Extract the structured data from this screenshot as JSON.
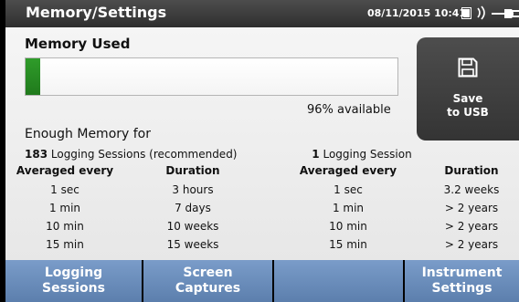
{
  "header": {
    "title": "Memory/Settings",
    "datetime": "08/11/2015 10:41",
    "icons": [
      "battery-icon",
      "wireless-icon",
      "ac-power-icon"
    ]
  },
  "memory": {
    "title": "Memory Used",
    "used_fraction": 0.04,
    "available_label": "96% available",
    "bar_color": "#2a8f25"
  },
  "save_button": {
    "icon": "floppy-disk-icon",
    "line1": "Save",
    "line2": "to USB"
  },
  "enough_label": "Enough Memory for",
  "left_table": {
    "count": "183",
    "caption": " Logging Sessions (recommended)",
    "headers": [
      "Averaged every",
      "Duration"
    ],
    "rows": [
      [
        "1 sec",
        "3 hours"
      ],
      [
        "1 min",
        "7 days"
      ],
      [
        "10 min",
        "10 weeks"
      ],
      [
        "15 min",
        "15 weeks"
      ]
    ]
  },
  "right_table": {
    "count": "1",
    "caption": " Logging Session",
    "headers": [
      "Averaged every",
      "Duration"
    ],
    "rows": [
      [
        "1 sec",
        "3.2 weeks"
      ],
      [
        "1 min",
        "> 2 years"
      ],
      [
        "10 min",
        "> 2 years"
      ],
      [
        "15 min",
        "> 2 years"
      ]
    ]
  },
  "tabs": [
    {
      "line1": "Logging",
      "line2": "Sessions"
    },
    {
      "line1": "Screen",
      "line2": "Captures"
    },
    {
      "line1": "",
      "line2": ""
    },
    {
      "line1": "Instrument",
      "line2": "Settings"
    }
  ],
  "colors": {
    "tab_background": "#6b8dbb",
    "header_background": "#3c3c3c",
    "save_button_background": "#404040"
  }
}
